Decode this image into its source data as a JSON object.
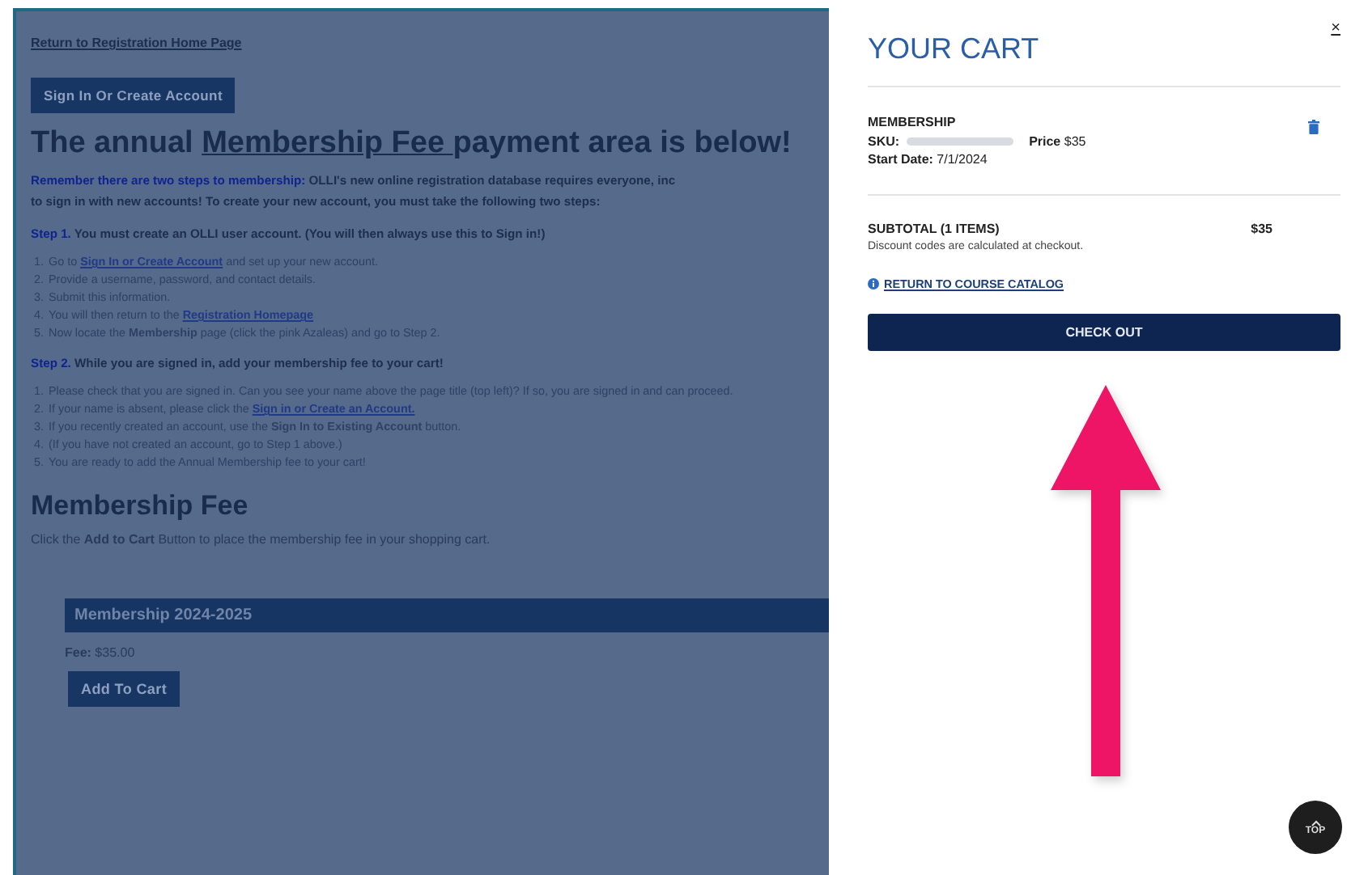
{
  "page": {
    "return_link": "Return to Registration Home Page",
    "sign_in_button": "Sign In Or Create Account",
    "heading": [
      {
        "kind": "plain",
        "text": "The annual "
      },
      {
        "kind": "link",
        "text": "Membership Fee "
      },
      {
        "kind": "plain",
        "text": " payment area is below!"
      }
    ],
    "intro_lines": [
      [
        {
          "kind": "accent",
          "text": "Remember there are two steps to membership:"
        },
        {
          "kind": "bold",
          "text": " OLLI's new online registration database requires everyone, inc"
        }
      ],
      [
        {
          "kind": "bold",
          "text": "to sign in with new accounts! To create your new account, you must take the following two steps:"
        }
      ]
    ],
    "steps": [
      {
        "title": [
          {
            "kind": "accent",
            "text": "Step 1."
          },
          {
            "kind": "bold",
            "text": " You must create an OLLI user account. (You will then always use this to Sign in!)"
          }
        ],
        "items": [
          {
            "marker": "1.",
            "parts": [
              {
                "kind": "plain",
                "text": "Go to "
              },
              {
                "kind": "link",
                "text": "Sign In or Create Account"
              },
              {
                "kind": "plain",
                "text": " and set up your new account."
              }
            ]
          },
          {
            "marker": "2.",
            "parts": [
              {
                "kind": "plain",
                "text": "Provide a username, password, and contact details."
              }
            ]
          },
          {
            "marker": "3.",
            "parts": [
              {
                "kind": "plain",
                "text": "Submit this information."
              }
            ]
          },
          {
            "marker": "4.",
            "parts": [
              {
                "kind": "plain",
                "text": "You will then return to the "
              },
              {
                "kind": "link",
                "text": "Registration Homepage"
              }
            ]
          },
          {
            "marker": "5.",
            "parts": [
              {
                "kind": "plain",
                "text": "Now locate the "
              },
              {
                "kind": "bold",
                "text": "Membership"
              },
              {
                "kind": "plain",
                "text": " page (click the pink Azaleas) and go to Step 2."
              }
            ]
          }
        ]
      },
      {
        "title": [
          {
            "kind": "accent",
            "text": "Step 2."
          },
          {
            "kind": "bold",
            "text": " While you are signed in, add your membership fee to your cart!"
          }
        ],
        "items": [
          {
            "marker": "1.",
            "parts": [
              {
                "kind": "plain",
                "text": "Please check that you are signed in. Can you see your name above the page title (top left)? If so, you are signed in and can proceed."
              }
            ]
          },
          {
            "marker": "2.",
            "parts": [
              {
                "kind": "plain",
                "text": "If your name is absent, please click the "
              },
              {
                "kind": "link",
                "text": "Sign in or Create an Account."
              }
            ]
          },
          {
            "marker": "3.",
            "parts": [
              {
                "kind": "plain",
                "text": "If you recently created an account, use the "
              },
              {
                "kind": "bold",
                "text": "Sign In to Existing Account"
              },
              {
                "kind": "plain",
                "text": " button."
              }
            ]
          },
          {
            "marker": "4.",
            "parts": [
              {
                "kind": "plain",
                "text": "(If you have not created an account, go to Step 1 above.)"
              }
            ]
          },
          {
            "marker": "5.",
            "parts": [
              {
                "kind": "plain",
                "text": "You are ready to add the Annual Membership fee to your cart!"
              }
            ]
          }
        ]
      }
    ],
    "section_title": "Membership Fee",
    "section_text": [
      {
        "kind": "plain",
        "text": "Click the "
      },
      {
        "kind": "bold",
        "text": "Add to Cart"
      },
      {
        "kind": "plain",
        "text": " Button to place the membership fee in your shopping cart."
      }
    ],
    "product": {
      "title": "Membership 2024-2025",
      "fee_label": "Fee:",
      "fee": "$35.00",
      "button": "Add To Cart"
    }
  },
  "cart": {
    "title": "YOUR CART",
    "close": "×",
    "item": {
      "name": "MEMBERSHIP",
      "sku_label": "SKU:",
      "price_label": "Price",
      "price": "$35",
      "date_label": "Start Date:",
      "date": "7/1/2024"
    },
    "subtotal_label": "SUBTOTAL (1 ITEMS)",
    "subtotal": "$35",
    "discount_note": "Discount codes are calculated at checkout.",
    "return_link": "RETURN TO COURSE CATALOG",
    "checkout_button": "CHECK OUT"
  },
  "top_button": "TOP"
}
